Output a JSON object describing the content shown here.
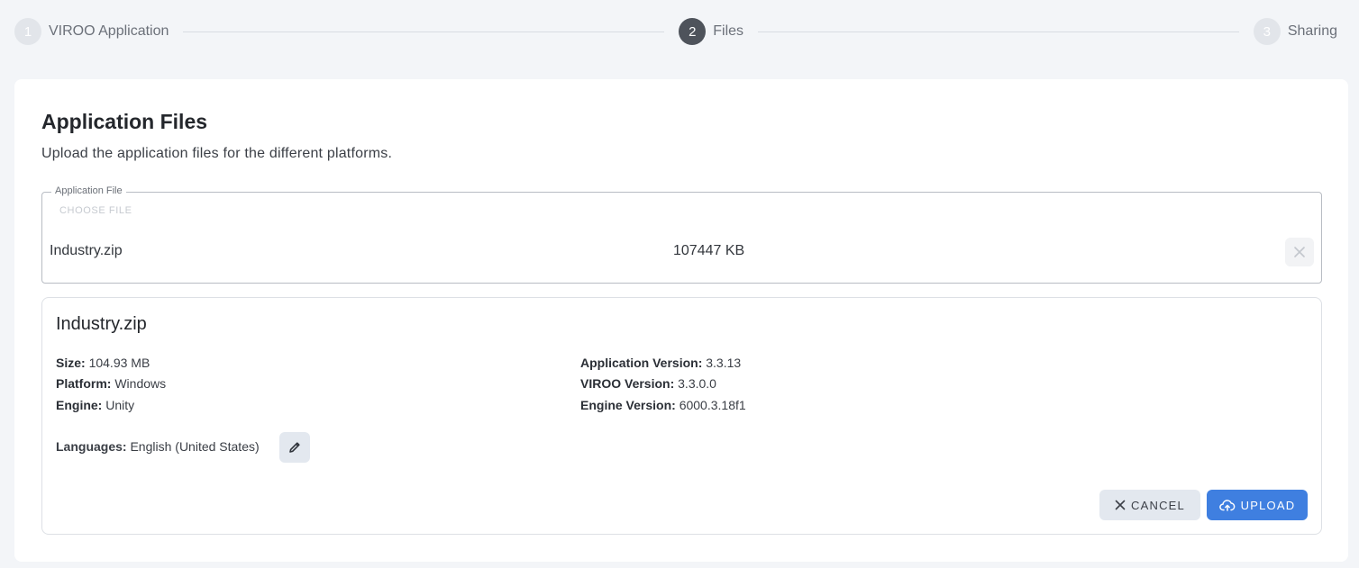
{
  "stepper": {
    "steps": [
      {
        "number": "1",
        "label": "VIROO Application",
        "state": "inactive"
      },
      {
        "number": "2",
        "label": "Files",
        "state": "active"
      },
      {
        "number": "3",
        "label": "Sharing",
        "state": "inactive"
      }
    ]
  },
  "page": {
    "title": "Application Files",
    "subtitle": "Upload the application files for the different platforms."
  },
  "file_field": {
    "legend": "Application File",
    "choose_label": "CHOOSE FILE",
    "file_name": "Industry.zip",
    "file_size": "107447 KB",
    "remove_icon": "close-icon"
  },
  "details": {
    "title": "Industry.zip",
    "size_label": "Size:",
    "size_value": "104.93 MB",
    "platform_label": "Platform:",
    "platform_value": "Windows",
    "engine_label": "Engine:",
    "engine_value": "Unity",
    "app_version_label": "Application Version:",
    "app_version_value": "3.3.13",
    "viroo_version_label": "VIROO Version:",
    "viroo_version_value": "3.3.0.0",
    "engine_version_label": "Engine Version:",
    "engine_version_value": "6000.3.18f1",
    "languages_label": "Languages:",
    "languages_value": "English (United States)",
    "edit_icon": "pencil-icon"
  },
  "actions": {
    "cancel_label": "CANCEL",
    "upload_label": "UPLOAD",
    "cancel_icon": "close-icon",
    "upload_icon": "cloud-upload-icon"
  },
  "colors": {
    "accent": "#3f7fe0",
    "active_step": "#4e535b",
    "inactive_step": "#e2e5ea",
    "background": "#f3f5f8"
  }
}
